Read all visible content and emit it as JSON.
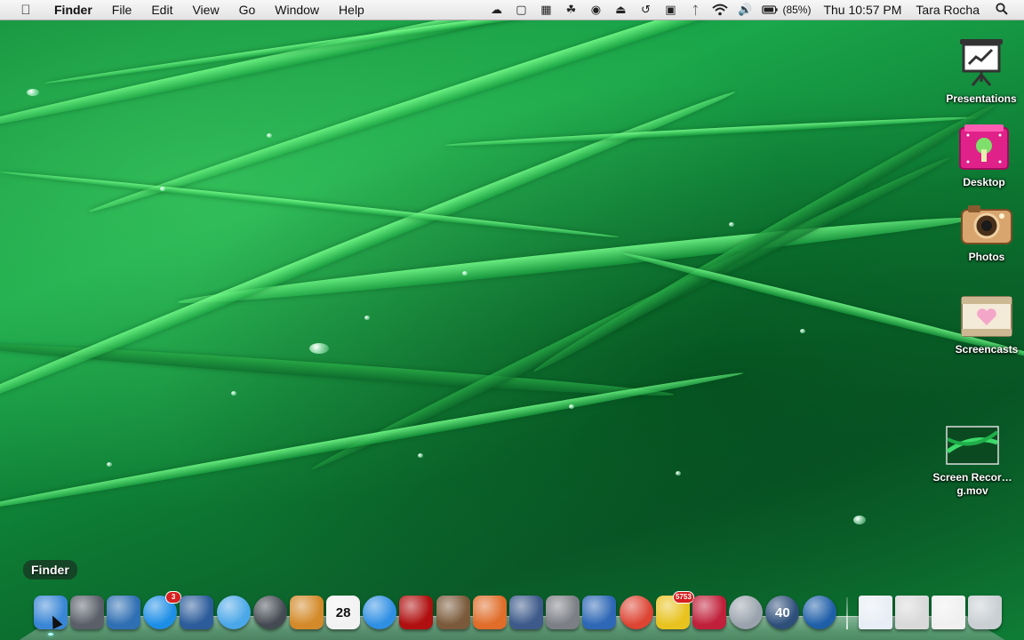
{
  "menubar": {
    "apple_icon": "apple-icon",
    "app_name": "Finder",
    "menus": [
      "File",
      "Edit",
      "View",
      "Go",
      "Window",
      "Help"
    ],
    "battery_percent": "(85%)",
    "clock": "Thu 10:57 PM",
    "user": "Tara Rocha",
    "tray_icons": [
      "cloud-icon",
      "display-icon",
      "screen-share-icon",
      "evernote-icon",
      "lock-icon",
      "eject-icon",
      "time-machine-icon",
      "monitor-icon",
      "bluetooth-icon",
      "wifi-icon",
      "volume-icon",
      "battery-icon"
    ]
  },
  "desktop_icons": [
    {
      "label": "Presentations",
      "icon": "presentation-board-icon"
    },
    {
      "label": "Desktop",
      "icon": "pink-folder-icon"
    },
    {
      "label": "Photos",
      "icon": "camera-icon"
    },
    {
      "label": "Screencasts",
      "icon": "film-heart-icon"
    },
    {
      "label": "Screen Recor…g.mov",
      "icon": "movie-thumbnail-icon"
    }
  ],
  "tooltip": "Finder",
  "dock": {
    "apps": [
      {
        "name": "Finder",
        "color": "#3a86d6"
      },
      {
        "name": "Launchpad",
        "color": "#5a5f69"
      },
      {
        "name": "Mission Control",
        "color": "#2f6fb3"
      },
      {
        "name": "App Store",
        "color": "#1d8ee6",
        "badge": "3"
      },
      {
        "name": "Preview",
        "color": "#2c5c9a"
      },
      {
        "name": "Safari",
        "color": "#4aa7e8"
      },
      {
        "name": "FaceTime",
        "color": "#444a52"
      },
      {
        "name": "Notebooks",
        "color": "#d38a2a"
      },
      {
        "name": "Calendar",
        "color": "#f2f2f2",
        "text": "28"
      },
      {
        "name": "iTunes",
        "color": "#2f8fe3"
      },
      {
        "name": "Photo Booth",
        "color": "#b01010"
      },
      {
        "name": "iPhoto",
        "color": "#7a5a3a"
      },
      {
        "name": "Keynote",
        "color": "#e06d2a"
      },
      {
        "name": "Script Editor",
        "color": "#3d5a8a"
      },
      {
        "name": "System Preferences",
        "color": "#7c7f85"
      },
      {
        "name": "Office",
        "color": "#2d67b5"
      },
      {
        "name": "Chrome",
        "color": "#dd4433"
      },
      {
        "name": "Messages",
        "color": "#e8c320",
        "badge": "5753"
      },
      {
        "name": "Reader",
        "color": "#c0203a"
      },
      {
        "name": "DVD Player",
        "color": "#9aa3ad"
      },
      {
        "name": "Time Machine",
        "color": "#2e4f7a",
        "text": "40"
      },
      {
        "name": "QuickTime",
        "color": "#1f5fa8"
      }
    ],
    "stacks": [
      {
        "name": "Documents",
        "color": "#e8eef5"
      },
      {
        "name": "Applications",
        "color": "#d9d9d9"
      },
      {
        "name": "Downloads",
        "color": "#f0f0f0"
      }
    ],
    "trash": {
      "name": "Trash",
      "color": "#c9cfd3"
    }
  }
}
